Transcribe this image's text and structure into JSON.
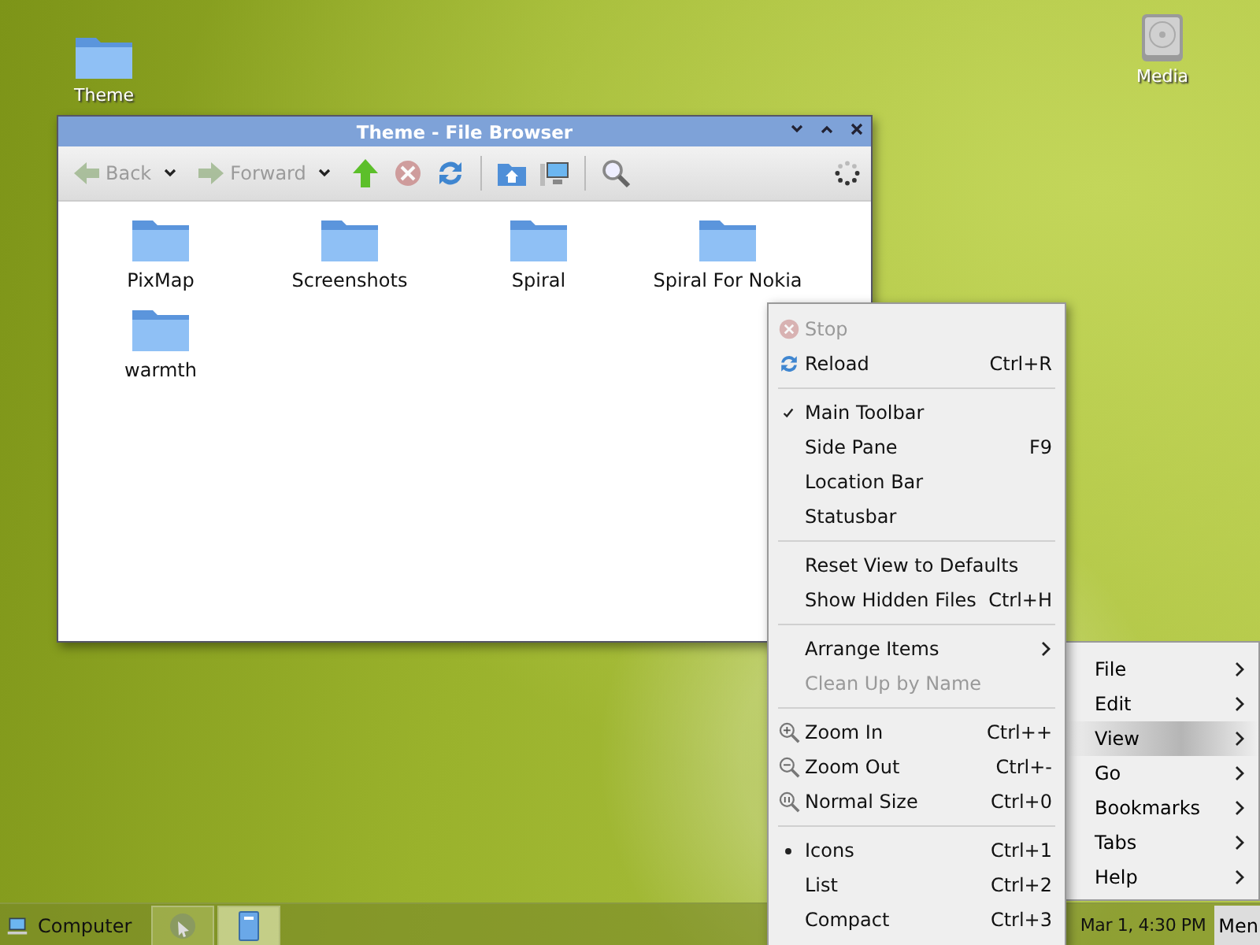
{
  "desktop_icons": [
    {
      "kind": "folder",
      "label": "Theme"
    },
    {
      "kind": "drive",
      "label": "Media"
    }
  ],
  "window": {
    "title": "Theme - File Browser",
    "toolbar": [
      {
        "kind": "back",
        "label": "Back",
        "disabled": true
      },
      {
        "kind": "forward",
        "label": "Forward",
        "disabled": true
      },
      {
        "kind": "up",
        "disabled": false
      },
      {
        "kind": "stop",
        "disabled": true
      },
      {
        "kind": "reload",
        "disabled": false
      },
      {
        "kind": "separator"
      },
      {
        "kind": "home",
        "disabled": false
      },
      {
        "kind": "computer",
        "disabled": false
      },
      {
        "kind": "separator"
      },
      {
        "kind": "search",
        "disabled": false
      }
    ],
    "files": [
      {
        "label": "PixMap"
      },
      {
        "label": "Screenshots"
      },
      {
        "label": "Spiral"
      },
      {
        "label": "Spiral For Nokia"
      },
      {
        "label": "warmth"
      }
    ]
  },
  "context_menu": {
    "sections": [
      {
        "items": [
          {
            "kind": "stop",
            "label": "Stop",
            "disabled": true
          },
          {
            "kind": "reload",
            "label": "Reload",
            "shortcut": "Ctrl+R",
            "disabled": false
          }
        ]
      },
      {
        "items": [
          {
            "kind": "check",
            "label": "Main Toolbar",
            "checked": true,
            "disabled": false
          },
          {
            "kind": "check",
            "label": "Side Pane",
            "shortcut": "F9",
            "checked": false,
            "disabled": false
          },
          {
            "kind": "check",
            "label": "Location Bar",
            "checked": false,
            "disabled": false
          },
          {
            "kind": "check",
            "label": "Statusbar",
            "checked": false,
            "disabled": false
          }
        ]
      },
      {
        "items": [
          {
            "kind": "plain",
            "label": "Reset View to Defaults",
            "disabled": false
          },
          {
            "kind": "plain",
            "label": "Show Hidden Files",
            "shortcut": "Ctrl+H",
            "disabled": false
          }
        ]
      },
      {
        "items": [
          {
            "kind": "submenu",
            "label": "Arrange Items",
            "disabled": false
          },
          {
            "kind": "plain",
            "label": "Clean Up by Name",
            "disabled": true
          }
        ]
      },
      {
        "items": [
          {
            "kind": "zoomin",
            "label": "Zoom In",
            "shortcut": "Ctrl++",
            "disabled": false
          },
          {
            "kind": "zoomout",
            "label": "Zoom Out",
            "shortcut": "Ctrl+-",
            "disabled": false
          },
          {
            "kind": "zoomreset",
            "label": "Normal Size",
            "shortcut": "Ctrl+0",
            "disabled": false
          }
        ]
      },
      {
        "items": [
          {
            "kind": "radio",
            "label": "Icons",
            "shortcut": "Ctrl+1",
            "checked": true,
            "disabled": false
          },
          {
            "kind": "radio",
            "label": "List",
            "shortcut": "Ctrl+2",
            "checked": false,
            "disabled": false
          },
          {
            "kind": "radio",
            "label": "Compact",
            "shortcut": "Ctrl+3",
            "checked": false,
            "disabled": false
          }
        ]
      }
    ]
  },
  "app_menu": {
    "items": [
      {
        "label": "File",
        "selected": false
      },
      {
        "label": "Edit",
        "selected": false
      },
      {
        "label": "View",
        "selected": true
      },
      {
        "label": "Go",
        "selected": false
      },
      {
        "label": "Bookmarks",
        "selected": false
      },
      {
        "label": "Tabs",
        "selected": false
      },
      {
        "label": "Help",
        "selected": false
      }
    ]
  },
  "taskbar": {
    "start": {
      "label": "Computer"
    },
    "tasks": [
      {
        "kind": "web",
        "selected": false
      },
      {
        "kind": "files",
        "selected": true
      }
    ],
    "clock": "Mar 1, 4:30 PM",
    "menu_button": "Men"
  }
}
